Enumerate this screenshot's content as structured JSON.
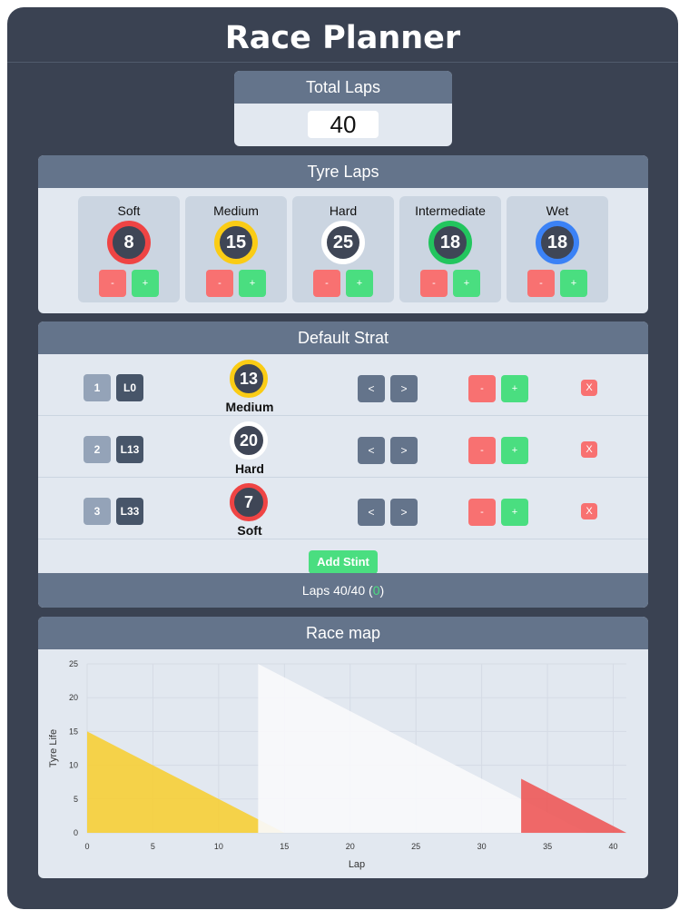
{
  "app": {
    "title": "Race Planner"
  },
  "total_laps": {
    "label": "Total Laps",
    "value": "40"
  },
  "tyre_laps": {
    "label": "Tyre Laps",
    "tyres": [
      {
        "name": "Soft",
        "laps": "8",
        "color": "#ef4444"
      },
      {
        "name": "Medium",
        "laps": "15",
        "color": "#facc15"
      },
      {
        "name": "Hard",
        "laps": "25",
        "color": "#ffffff"
      },
      {
        "name": "Intermediate",
        "laps": "18",
        "color": "#22c55e"
      },
      {
        "name": "Wet",
        "laps": "18",
        "color": "#3b82f6"
      }
    ],
    "minus_label": "-",
    "plus_label": "+"
  },
  "strat": {
    "label": "Default Strat",
    "stints": [
      {
        "num": "1",
        "start": "L0",
        "laps": "13",
        "tyre": "Medium",
        "color": "#facc15"
      },
      {
        "num": "2",
        "start": "L13",
        "laps": "20",
        "tyre": "Hard",
        "color": "#ffffff"
      },
      {
        "num": "3",
        "start": "L33",
        "laps": "7",
        "tyre": "Soft",
        "color": "#ef4444"
      }
    ],
    "prev_label": "<",
    "next_label": ">",
    "minus_label": "-",
    "plus_label": "+",
    "remove_label": "X",
    "add_label": "Add Stint",
    "footer": {
      "prefix": "Laps 40/40 (",
      "diff": "0",
      "suffix": ")"
    }
  },
  "race_map": {
    "label": "Race map",
    "chart_data": {
      "type": "area",
      "xlabel": "Lap",
      "ylabel": "Tyre Life",
      "xlim": [
        0,
        41
      ],
      "ylim": [
        0,
        25
      ],
      "xticks": [
        "0",
        "5",
        "10",
        "15",
        "20",
        "25",
        "30",
        "35",
        "40"
      ],
      "yticks": [
        "0",
        "5",
        "10",
        "15",
        "20",
        "25"
      ],
      "grid": true,
      "series": [
        {
          "tyre": "Medium",
          "color": "#f6cf3b",
          "points": [
            [
              0,
              15
            ],
            [
              13,
              2
            ],
            [
              15,
              0
            ],
            [
              0,
              0
            ]
          ]
        },
        {
          "tyre": "Hard",
          "color": "#f8f9fb",
          "points": [
            [
              13,
              25
            ],
            [
              33,
              5
            ],
            [
              38,
              0
            ],
            [
              13,
              0
            ]
          ]
        },
        {
          "tyre": "Soft",
          "color": "#ee5b5b",
          "points": [
            [
              33,
              8
            ],
            [
              41,
              0
            ],
            [
              33,
              0
            ]
          ]
        }
      ]
    }
  }
}
